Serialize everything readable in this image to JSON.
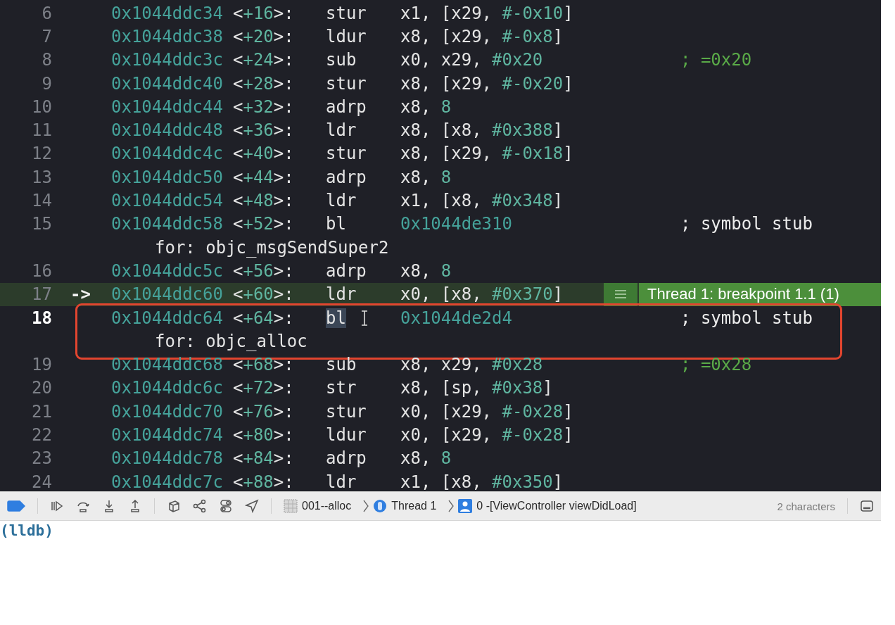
{
  "disassembly": {
    "lines": [
      {
        "number": "6",
        "current": false,
        "breakpoint": false,
        "annotated": false,
        "mnemonic_selected": false,
        "cursor": false,
        "address": "0x1044ddc34",
        "offset": [
          {
            "t": "<",
            "kind": "plain"
          },
          {
            "t": "+16",
            "kind": "num"
          },
          {
            "t": ">:",
            "kind": "plain"
          }
        ],
        "mnemonic": "stur",
        "operands": [
          {
            "t": "x1, [x29, ",
            "kind": "plain"
          },
          {
            "t": "#-0x10",
            "kind": "num"
          },
          {
            "t": "]",
            "kind": "plain"
          }
        ]
      },
      {
        "number": "7",
        "current": false,
        "breakpoint": false,
        "annotated": false,
        "mnemonic_selected": false,
        "cursor": false,
        "address": "0x1044ddc38",
        "offset": [
          {
            "t": "<",
            "kind": "plain"
          },
          {
            "t": "+20",
            "kind": "num"
          },
          {
            "t": ">:",
            "kind": "plain"
          }
        ],
        "mnemonic": "ldur",
        "operands": [
          {
            "t": "x8, [x29, ",
            "kind": "plain"
          },
          {
            "t": "#-0x8",
            "kind": "num"
          },
          {
            "t": "]",
            "kind": "plain"
          }
        ]
      },
      {
        "number": "8",
        "current": false,
        "breakpoint": false,
        "annotated": false,
        "mnemonic_selected": false,
        "cursor": false,
        "address": "0x1044ddc3c",
        "offset": [
          {
            "t": "<",
            "kind": "plain"
          },
          {
            "t": "+24",
            "kind": "num"
          },
          {
            "t": ">:",
            "kind": "plain"
          }
        ],
        "mnemonic": "sub",
        "operands": [
          {
            "t": "x0, x29, ",
            "kind": "plain"
          },
          {
            "t": "#0x20",
            "kind": "num"
          }
        ],
        "comment": {
          "text": "; =0x20",
          "kind": "value"
        }
      },
      {
        "number": "9",
        "current": false,
        "breakpoint": false,
        "annotated": false,
        "mnemonic_selected": false,
        "cursor": false,
        "address": "0x1044ddc40",
        "offset": [
          {
            "t": "<",
            "kind": "plain"
          },
          {
            "t": "+28",
            "kind": "num"
          },
          {
            "t": ">:",
            "kind": "plain"
          }
        ],
        "mnemonic": "stur",
        "operands": [
          {
            "t": "x8, [x29, ",
            "kind": "plain"
          },
          {
            "t": "#-0x20",
            "kind": "num"
          },
          {
            "t": "]",
            "kind": "plain"
          }
        ]
      },
      {
        "number": "10",
        "current": false,
        "breakpoint": false,
        "annotated": false,
        "mnemonic_selected": false,
        "cursor": false,
        "address": "0x1044ddc44",
        "offset": [
          {
            "t": "<",
            "kind": "plain"
          },
          {
            "t": "+32",
            "kind": "num"
          },
          {
            "t": ">:",
            "kind": "plain"
          }
        ],
        "mnemonic": "adrp",
        "operands": [
          {
            "t": "x8, ",
            "kind": "plain"
          },
          {
            "t": "8",
            "kind": "num"
          }
        ]
      },
      {
        "number": "11",
        "current": false,
        "breakpoint": false,
        "annotated": false,
        "mnemonic_selected": false,
        "cursor": false,
        "address": "0x1044ddc48",
        "offset": [
          {
            "t": "<",
            "kind": "plain"
          },
          {
            "t": "+36",
            "kind": "num"
          },
          {
            "t": ">:",
            "kind": "plain"
          }
        ],
        "mnemonic": "ldr",
        "operands": [
          {
            "t": "x8, [x8, ",
            "kind": "plain"
          },
          {
            "t": "#0x388",
            "kind": "num"
          },
          {
            "t": "]",
            "kind": "plain"
          }
        ]
      },
      {
        "number": "12",
        "current": false,
        "breakpoint": false,
        "annotated": false,
        "mnemonic_selected": false,
        "cursor": false,
        "address": "0x1044ddc4c",
        "offset": [
          {
            "t": "<",
            "kind": "plain"
          },
          {
            "t": "+40",
            "kind": "num"
          },
          {
            "t": ">:",
            "kind": "plain"
          }
        ],
        "mnemonic": "stur",
        "operands": [
          {
            "t": "x8, [x29, ",
            "kind": "plain"
          },
          {
            "t": "#-0x18",
            "kind": "num"
          },
          {
            "t": "]",
            "kind": "plain"
          }
        ]
      },
      {
        "number": "13",
        "current": false,
        "breakpoint": false,
        "annotated": false,
        "mnemonic_selected": false,
        "cursor": false,
        "address": "0x1044ddc50",
        "offset": [
          {
            "t": "<",
            "kind": "plain"
          },
          {
            "t": "+44",
            "kind": "num"
          },
          {
            "t": ">:",
            "kind": "plain"
          }
        ],
        "mnemonic": "adrp",
        "operands": [
          {
            "t": "x8, ",
            "kind": "plain"
          },
          {
            "t": "8",
            "kind": "num"
          }
        ]
      },
      {
        "number": "14",
        "current": false,
        "breakpoint": false,
        "annotated": false,
        "mnemonic_selected": false,
        "cursor": false,
        "address": "0x1044ddc54",
        "offset": [
          {
            "t": "<",
            "kind": "plain"
          },
          {
            "t": "+48",
            "kind": "num"
          },
          {
            "t": ">:",
            "kind": "plain"
          }
        ],
        "mnemonic": "ldr",
        "operands": [
          {
            "t": "x1, [x8, ",
            "kind": "plain"
          },
          {
            "t": "#0x348",
            "kind": "num"
          },
          {
            "t": "]",
            "kind": "plain"
          }
        ]
      },
      {
        "number": "15",
        "current": false,
        "breakpoint": false,
        "annotated": false,
        "mnemonic_selected": false,
        "cursor": false,
        "address": "0x1044ddc58",
        "offset": [
          {
            "t": "<",
            "kind": "plain"
          },
          {
            "t": "+52",
            "kind": "num"
          },
          {
            "t": ">:",
            "kind": "plain"
          }
        ],
        "mnemonic": "bl",
        "operands": [
          {
            "t": "0x1044de310",
            "kind": "addr"
          }
        ],
        "comment": {
          "text": "; symbol stub",
          "kind": "note"
        },
        "continuation": "for: objc_msgSendSuper2"
      },
      {
        "number": "16",
        "current": false,
        "breakpoint": false,
        "annotated": false,
        "mnemonic_selected": false,
        "cursor": false,
        "address": "0x1044ddc5c",
        "offset": [
          {
            "t": "<",
            "kind": "plain"
          },
          {
            "t": "+56",
            "kind": "num"
          },
          {
            "t": ">:",
            "kind": "plain"
          }
        ],
        "mnemonic": "adrp",
        "operands": [
          {
            "t": "x8, ",
            "kind": "plain"
          },
          {
            "t": "8",
            "kind": "num"
          }
        ]
      },
      {
        "number": "17",
        "current": false,
        "breakpoint": true,
        "annotated": false,
        "mnemonic_selected": false,
        "cursor": false,
        "marker": "->",
        "address": "0x1044ddc60",
        "offset": [
          {
            "t": "<",
            "kind": "plain"
          },
          {
            "t": "+60",
            "kind": "num"
          },
          {
            "t": ">:",
            "kind": "plain"
          }
        ],
        "mnemonic": "ldr",
        "operands": [
          {
            "t": "x0, [x8, ",
            "kind": "plain"
          },
          {
            "t": "#0x370",
            "kind": "num"
          },
          {
            "t": "]",
            "kind": "plain"
          }
        ],
        "badge": "Thread 1: breakpoint 1.1 (1)"
      },
      {
        "number": "18",
        "current": true,
        "breakpoint": false,
        "annotated": true,
        "mnemonic_selected": true,
        "cursor": true,
        "address": "0x1044ddc64",
        "offset": [
          {
            "t": "<",
            "kind": "plain"
          },
          {
            "t": "+64",
            "kind": "num"
          },
          {
            "t": ">:",
            "kind": "plain"
          }
        ],
        "mnemonic": "bl",
        "operands": [
          {
            "t": "0x1044de2d4",
            "kind": "addr"
          }
        ],
        "comment": {
          "text": "; symbol stub",
          "kind": "note"
        },
        "continuation": "for: objc_alloc"
      },
      {
        "number": "19",
        "current": false,
        "breakpoint": false,
        "annotated": false,
        "mnemonic_selected": false,
        "cursor": false,
        "address": "0x1044ddc68",
        "offset": [
          {
            "t": "<",
            "kind": "plain"
          },
          {
            "t": "+68",
            "kind": "num"
          },
          {
            "t": ">:",
            "kind": "plain"
          }
        ],
        "mnemonic": "sub",
        "operands": [
          {
            "t": "x8, x29, ",
            "kind": "plain"
          },
          {
            "t": "#0x28",
            "kind": "num"
          }
        ],
        "comment": {
          "text": "; =0x28",
          "kind": "value"
        }
      },
      {
        "number": "20",
        "current": false,
        "breakpoint": false,
        "annotated": false,
        "mnemonic_selected": false,
        "cursor": false,
        "address": "0x1044ddc6c",
        "offset": [
          {
            "t": "<",
            "kind": "plain"
          },
          {
            "t": "+72",
            "kind": "num"
          },
          {
            "t": ">:",
            "kind": "plain"
          }
        ],
        "mnemonic": "str",
        "operands": [
          {
            "t": "x8, [sp, ",
            "kind": "plain"
          },
          {
            "t": "#0x38",
            "kind": "num"
          },
          {
            "t": "]",
            "kind": "plain"
          }
        ]
      },
      {
        "number": "21",
        "current": false,
        "breakpoint": false,
        "annotated": false,
        "mnemonic_selected": false,
        "cursor": false,
        "address": "0x1044ddc70",
        "offset": [
          {
            "t": "<",
            "kind": "plain"
          },
          {
            "t": "+76",
            "kind": "num"
          },
          {
            "t": ">:",
            "kind": "plain"
          }
        ],
        "mnemonic": "stur",
        "operands": [
          {
            "t": "x0, [x29, ",
            "kind": "plain"
          },
          {
            "t": "#-0x28",
            "kind": "num"
          },
          {
            "t": "]",
            "kind": "plain"
          }
        ]
      },
      {
        "number": "22",
        "current": false,
        "breakpoint": false,
        "annotated": false,
        "mnemonic_selected": false,
        "cursor": false,
        "address": "0x1044ddc74",
        "offset": [
          {
            "t": "<",
            "kind": "plain"
          },
          {
            "t": "+80",
            "kind": "num"
          },
          {
            "t": ">:",
            "kind": "plain"
          }
        ],
        "mnemonic": "ldur",
        "operands": [
          {
            "t": "x0, [x29, ",
            "kind": "plain"
          },
          {
            "t": "#-0x28",
            "kind": "num"
          },
          {
            "t": "]",
            "kind": "plain"
          }
        ]
      },
      {
        "number": "23",
        "current": false,
        "breakpoint": false,
        "annotated": false,
        "mnemonic_selected": false,
        "cursor": false,
        "address": "0x1044ddc78",
        "offset": [
          {
            "t": "<",
            "kind": "plain"
          },
          {
            "t": "+84",
            "kind": "num"
          },
          {
            "t": ">:",
            "kind": "plain"
          }
        ],
        "mnemonic": "adrp",
        "operands": [
          {
            "t": "x8, ",
            "kind": "plain"
          },
          {
            "t": "8",
            "kind": "num"
          }
        ]
      },
      {
        "number": "24",
        "current": false,
        "breakpoint": false,
        "annotated": false,
        "mnemonic_selected": false,
        "cursor": false,
        "address": "0x1044ddc7c",
        "offset": [
          {
            "t": "<",
            "kind": "plain"
          },
          {
            "t": "+88",
            "kind": "num"
          },
          {
            "t": ">:",
            "kind": "plain"
          }
        ],
        "mnemonic": "ldr",
        "operands": [
          {
            "t": "x1, [x8, ",
            "kind": "plain"
          },
          {
            "t": "#0x350",
            "kind": "num"
          },
          {
            "t": "]",
            "kind": "plain"
          }
        ]
      }
    ]
  },
  "debug_bar": {
    "breakpoints_on": true,
    "breadcrumbs": [
      {
        "kind": "app",
        "label": "001--alloc"
      },
      {
        "kind": "thread",
        "label": "Thread 1"
      },
      {
        "kind": "frame",
        "label": "0 -[ViewController viewDidLoad]"
      }
    ],
    "selection_info": "2 characters"
  },
  "console": {
    "prompt": "(lldb)"
  }
}
